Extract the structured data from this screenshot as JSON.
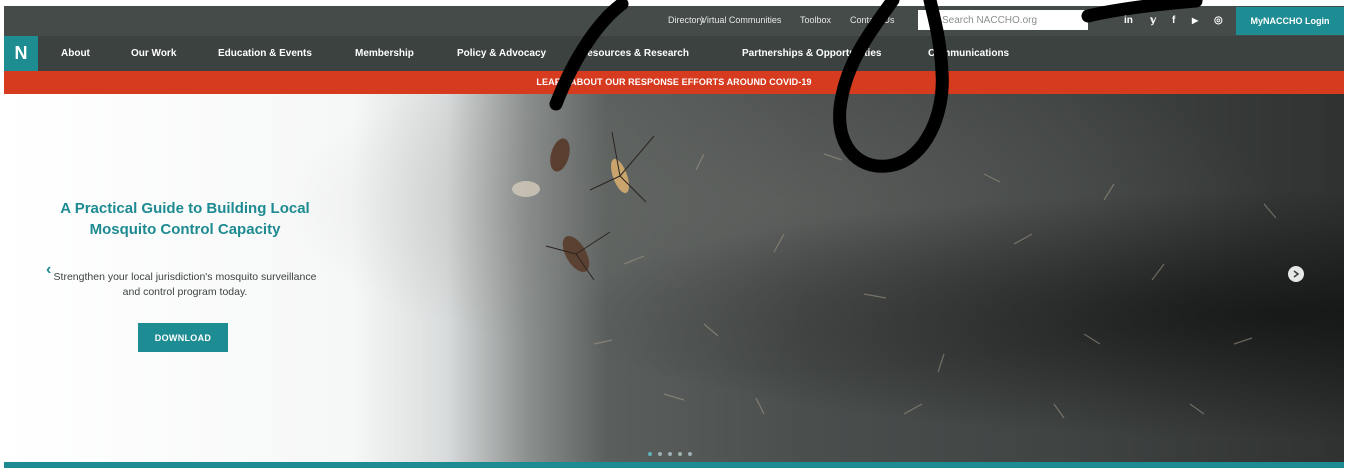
{
  "utility": {
    "links": [
      "Directory",
      "Virtual Communities",
      "Toolbox",
      "Contact Us"
    ],
    "search_placeholder": "Search NACCHO.org",
    "social_icons": [
      "linkedin-icon",
      "twitter-icon",
      "facebook-icon",
      "youtube-icon",
      "instagram-icon"
    ],
    "social_glyphs": [
      "in",
      "𝕪",
      "f",
      "▶",
      "◎"
    ],
    "login_label": "MyNACCHO Login"
  },
  "nav": {
    "logo": "N",
    "items": [
      "About",
      "Our Work",
      "Education & Events",
      "Membership",
      "Policy & Advocacy",
      "Resources & Research",
      "Partnerships & Opportunities",
      "Communications"
    ]
  },
  "alert": {
    "text": "LEARN ABOUT OUR RESPONSE EFFORTS AROUND COVID-19"
  },
  "hero": {
    "title": "A Practical Guide to Building Local Mosquito Control Capacity",
    "subtitle": "Strengthen your local jurisdiction's mosquito surveillance and control program today.",
    "button": "DOWNLOAD",
    "prev_glyph": "‹",
    "slide_count": 5,
    "active_slide": 1
  },
  "colors": {
    "brand_teal": "#1d8b91",
    "alert_red": "#d63b1f",
    "nav_bg": "#3b4240"
  }
}
